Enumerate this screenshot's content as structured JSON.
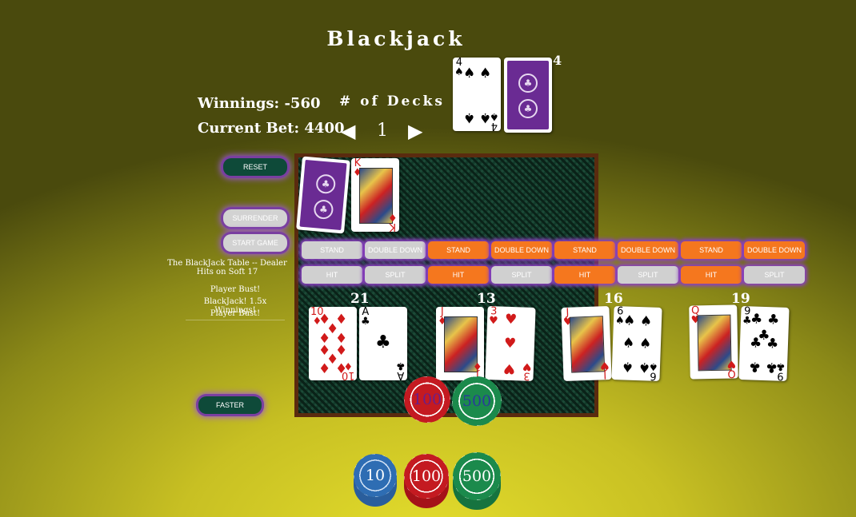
{
  "title": "Blackjack",
  "winnings": "Winnings: -560",
  "current_bet": "Current Bet: 4400",
  "decks": {
    "label": "# of Decks",
    "value": "1",
    "left_arrow": "◀",
    "right_arrow": "▶"
  },
  "shoe_count": "4",
  "controls": {
    "reset": "RESET",
    "surrender": "SURRENDER",
    "start_game": "START GAME",
    "faster": "FASTER"
  },
  "table_info": "The BlackJack Table -- Dealer Hits on Soft 17",
  "messages": [
    "Player Bust!",
    "BlackJack! 1.5x Winnings!",
    "Player Bust!"
  ],
  "action_buttons": {
    "stand": "STAND",
    "double_down": "DOUBLE DOWN",
    "hit": "HIT",
    "split": "SPLIT"
  },
  "hands": [
    {
      "score": "21",
      "cards": [
        {
          "rank": "10",
          "suit": "♦"
        },
        {
          "rank": "A",
          "suit": "♣"
        }
      ]
    },
    {
      "score": "13",
      "cards": [
        {
          "rank": "J",
          "suit": "♦"
        },
        {
          "rank": "3",
          "suit": "♥"
        }
      ]
    },
    {
      "score": "16",
      "cards": [
        {
          "rank": "J",
          "suit": "♥"
        },
        {
          "rank": "6",
          "suit": "♠"
        }
      ]
    },
    {
      "score": "19",
      "cards": [
        {
          "rank": "Q",
          "suit": "♥"
        },
        {
          "rank": "9",
          "suit": "♣"
        }
      ]
    }
  ],
  "dealer_cards": [
    {
      "rank": "K",
      "suit": "♦"
    }
  ],
  "shoe_top_card": {
    "rank": "4",
    "suit": "♠"
  },
  "bet_chips": [
    "100",
    "500"
  ],
  "chip_rack": [
    "10",
    "100",
    "500"
  ],
  "colors": {
    "chip_blue": "#2e6db3",
    "chip_red": "#c41a21",
    "chip_green": "#1b8a4c",
    "accent_purple": "#7a3fa0",
    "orange": "#f5771e"
  }
}
